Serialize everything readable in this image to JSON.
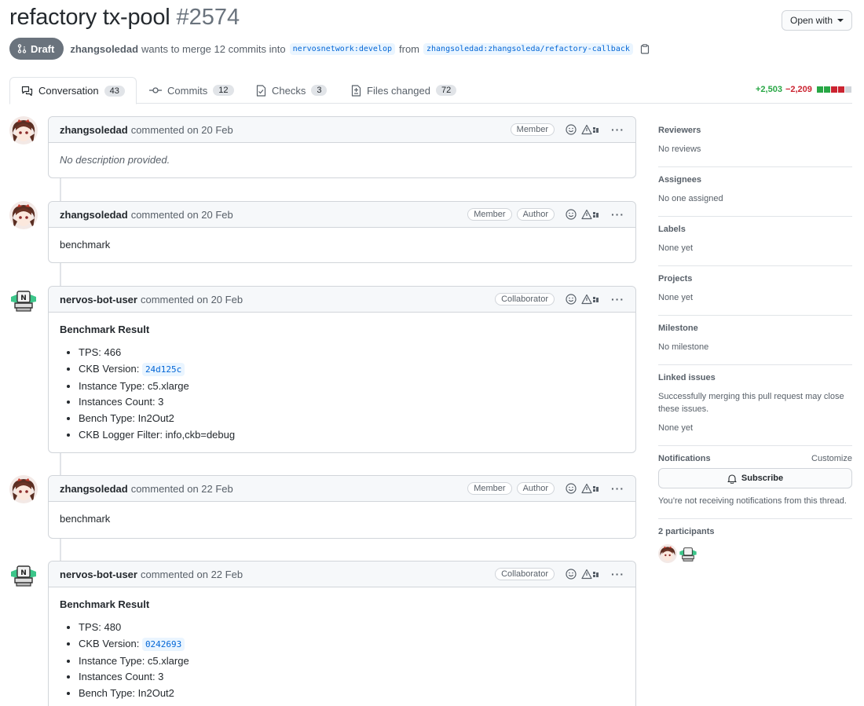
{
  "pr": {
    "title": "refactory tx-pool",
    "number": "#2574",
    "open_with": "Open with",
    "status": "Draft",
    "author": "zhangsoledad",
    "merge_text": "wants to merge 12 commits into",
    "base_branch": "nervosnetwork:develop",
    "from_text": "from",
    "head_branch": "zhangsoledad:zhangsoleda/refactory-callback"
  },
  "tabs": [
    {
      "label": "Conversation",
      "count": "43"
    },
    {
      "label": "Commits",
      "count": "12"
    },
    {
      "label": "Checks",
      "count": "3"
    },
    {
      "label": "Files changed",
      "count": "72"
    }
  ],
  "diffstat": {
    "additions": "+2,503",
    "deletions": "−2,209"
  },
  "comments": [
    {
      "author": "zhangsoledad",
      "meta": "commented on 20 Feb",
      "badges": [
        "Member"
      ],
      "body": "No description provided."
    },
    {
      "author": "zhangsoledad",
      "meta": "commented on 20 Feb",
      "badges": [
        "Member",
        "Author"
      ],
      "body": "benchmark"
    },
    {
      "author": "nervos-bot-user",
      "meta": "commented on 20 Feb",
      "badges": [
        "Collaborator"
      ],
      "heading": "Benchmark Result",
      "items": [
        {
          "label": "TPS: 466"
        },
        {
          "label": "CKB Version: ",
          "code": "24d125c"
        },
        {
          "label": "Instance Type: c5.xlarge"
        },
        {
          "label": "Instances Count: 3"
        },
        {
          "label": "Bench Type: In2Out2"
        },
        {
          "label": "CKB Logger Filter: info,ckb=debug"
        }
      ]
    },
    {
      "author": "zhangsoledad",
      "meta": "commented on 22 Feb",
      "badges": [
        "Member",
        "Author"
      ],
      "body": "benchmark"
    },
    {
      "author": "nervos-bot-user",
      "meta": "commented on 22 Feb",
      "badges": [
        "Collaborator"
      ],
      "heading": "Benchmark Result",
      "items": [
        {
          "label": "TPS: 480"
        },
        {
          "label": "CKB Version: ",
          "code": "0242693"
        },
        {
          "label": "Instance Type: c5.xlarge"
        },
        {
          "label": "Instances Count: 3"
        },
        {
          "label": "Bench Type: In2Out2"
        }
      ]
    }
  ],
  "sidebar": {
    "reviewers": {
      "title": "Reviewers",
      "value": "No reviews"
    },
    "assignees": {
      "title": "Assignees",
      "value": "No one assigned"
    },
    "labels": {
      "title": "Labels",
      "value": "None yet"
    },
    "projects": {
      "title": "Projects",
      "value": "None yet"
    },
    "milestone": {
      "title": "Milestone",
      "value": "No milestone"
    },
    "linked": {
      "title": "Linked issues",
      "desc": "Successfully merging this pull request may close these issues.",
      "value": "None yet"
    },
    "notifications": {
      "title": "Notifications",
      "customize": "Customize",
      "button": "Subscribe",
      "desc": "You’re not receiving notifications from this thread."
    },
    "participants": {
      "title": "2 participants"
    }
  },
  "colors": {
    "accent": "#0366d6",
    "draft": "#6a737d",
    "add": "#28a745",
    "del": "#cb2431"
  }
}
